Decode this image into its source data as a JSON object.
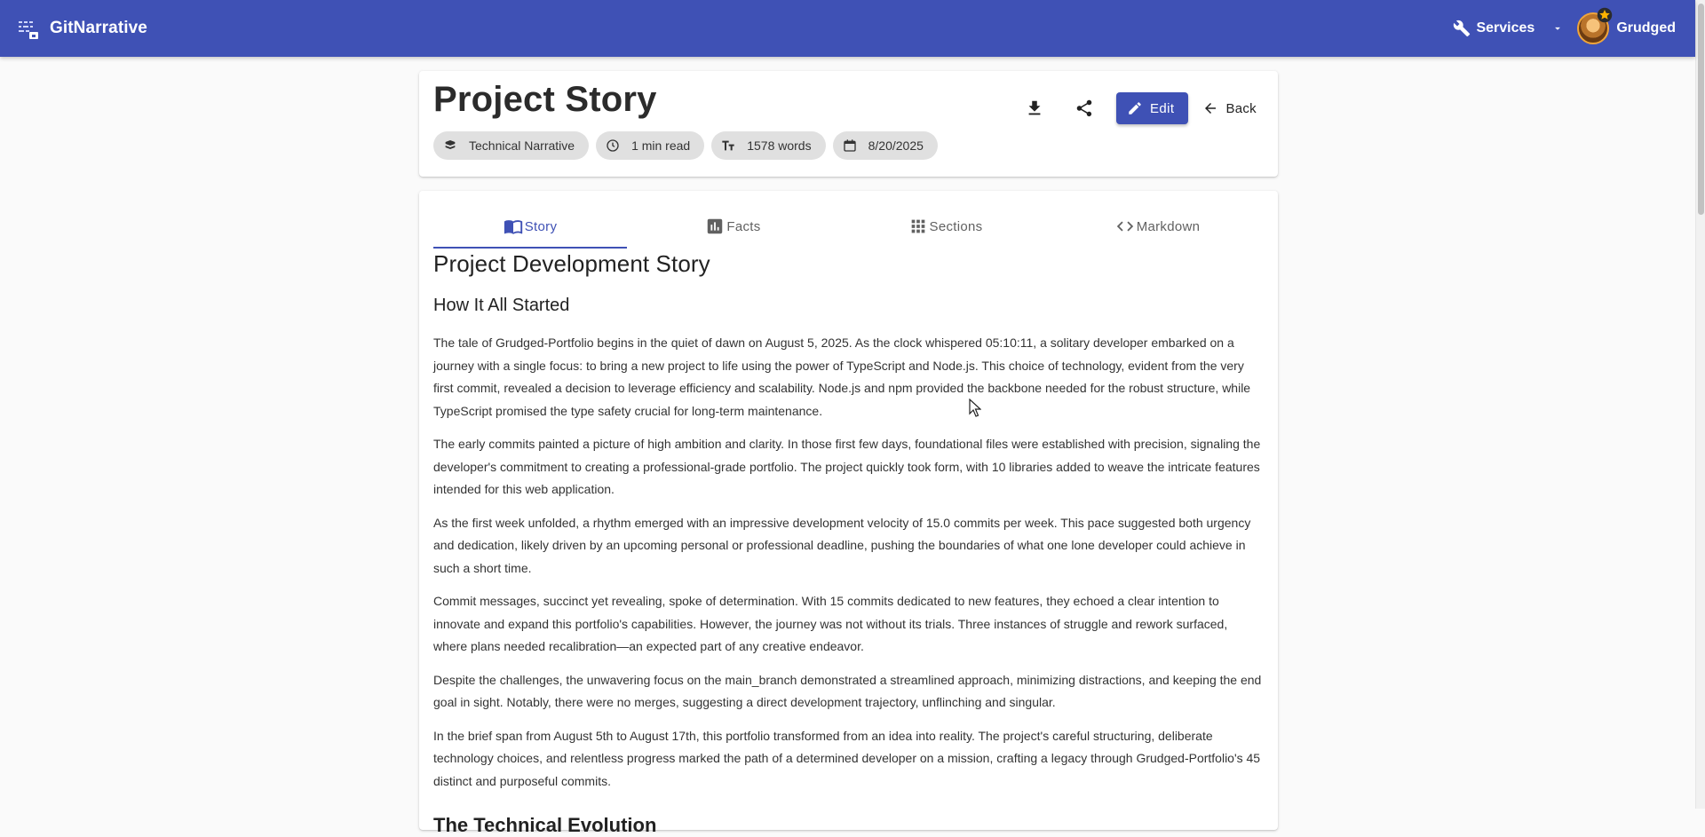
{
  "app": {
    "name": "GitNarrative",
    "services_label": "Services",
    "user_name": "Grudged"
  },
  "header": {
    "title": "Project Story",
    "chips": [
      {
        "icon": "book-type-icon",
        "label": "Technical Narrative"
      },
      {
        "icon": "clock-icon",
        "label": "1 min read"
      },
      {
        "icon": "text-size-icon",
        "label": "1578 words"
      },
      {
        "icon": "calendar-icon",
        "label": "8/20/2025"
      }
    ],
    "actions": {
      "download_icon": "download-icon",
      "share_icon": "share-icon",
      "edit_label": "Edit",
      "back_label": "Back"
    }
  },
  "tabs": [
    {
      "icon": "book-open-icon",
      "label": "Story",
      "active": true
    },
    {
      "icon": "bar-chart-icon",
      "label": "Facts",
      "active": false
    },
    {
      "icon": "grid-icon",
      "label": "Sections",
      "active": false
    },
    {
      "icon": "code-icon",
      "label": "Markdown",
      "active": false
    }
  ],
  "story": {
    "title": "Project Development Story",
    "section_heading": "How It All Started",
    "paragraphs": [
      "The tale of Grudged-Portfolio begins in the quiet of dawn on August 5, 2025. As the clock whispered 05:10:11, a solitary developer embarked on a journey with a single focus: to bring a new project to life using the power of TypeScript and Node.js. This choice of technology, evident from the very first commit, revealed a decision to leverage efficiency and scalability. Node.js and npm provided the backbone needed for the robust structure, while TypeScript promised the type safety crucial for long-term maintenance.",
      "The early commits painted a picture of high ambition and clarity. In those first few days, foundational files were established with precision, signaling the developer's commitment to creating a professional-grade portfolio. The project quickly took form, with 10 libraries added to weave the intricate features intended for this web application.",
      "As the first week unfolded, a rhythm emerged with an impressive development velocity of 15.0 commits per week. This pace suggested both urgency and dedication, likely driven by an upcoming personal or professional deadline, pushing the boundaries of what one lone developer could achieve in such a short time.",
      "Commit messages, succinct yet revealing, spoke of determination. With 15 commits dedicated to new features, they echoed a clear intention to innovate and expand this portfolio's capabilities. However, the journey was not without its trials. Three instances of struggle and rework surfaced, where plans needed recalibration—an expected part of any creative endeavor.",
      "Despite the challenges, the unwavering focus on the main_branch demonstrated a streamlined approach, minimizing distractions, and keeping the end goal in sight. Notably, there were no merges, suggesting a direct development trajectory, unflinching and singular.",
      "In the brief span from August 5th to August 17th, this portfolio transformed from an idea into reality. The project's careful structuring, deliberate technology choices, and relentless progress marked the path of a determined developer on a mission, crafting a legacy through Grudged-Portfolio's 45 distinct and purposeful commits."
    ],
    "next_heading": "The Technical Evolution"
  },
  "colors": {
    "primary": "#3f51b5",
    "chip_bg": "#e0e0e0",
    "page_bg": "#fafafa"
  }
}
